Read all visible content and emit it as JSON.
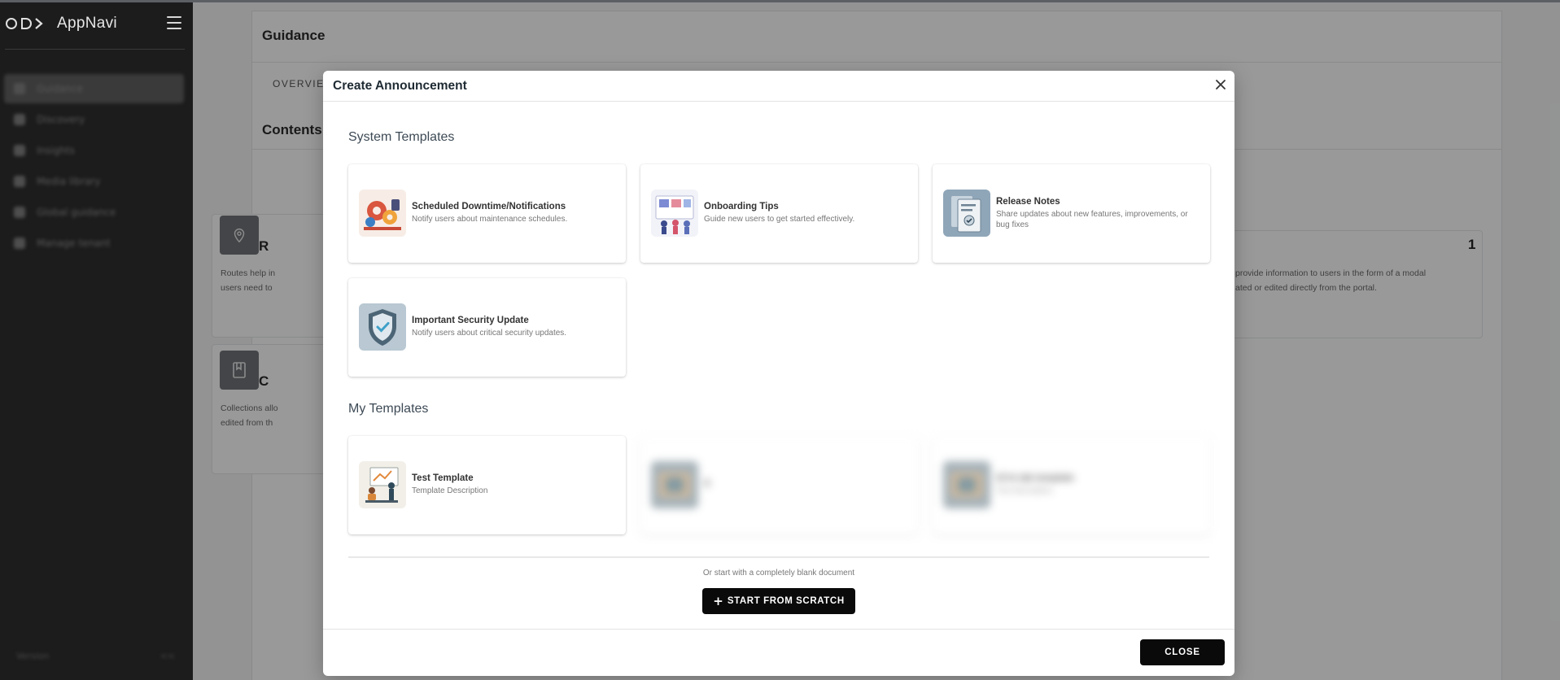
{
  "app": {
    "name": "AppNavi"
  },
  "sidebar": {
    "items": [
      {
        "label": "Guidance",
        "active": true
      },
      {
        "label": "Discovery"
      },
      {
        "label": "Insights"
      },
      {
        "label": "Media library"
      },
      {
        "label": "Global guidance"
      },
      {
        "label": "Manage tenant"
      }
    ],
    "footer": {
      "left": "Version",
      "right": "<<"
    }
  },
  "page": {
    "title": "Guidance",
    "tab_overview": "OVERVIEW",
    "contents_title": "Contents",
    "tiles": {
      "routes": {
        "initial": "R",
        "text1": "Routes help in",
        "text2": "users need to"
      },
      "collections": {
        "initial": "C",
        "text1": "Collections allo",
        "text2": "edited from th"
      },
      "announcements": {
        "count": "1",
        "text1": "provide information to users in the form of a modal",
        "text2": "ated or edited directly from the portal."
      }
    }
  },
  "modal": {
    "title": "Create Announcement",
    "system_heading": "System Templates",
    "my_heading": "My Templates",
    "system_templates": [
      {
        "name": "Scheduled Downtime/Notifications",
        "description": "Notify users about maintenance schedules."
      },
      {
        "name": "Onboarding Tips",
        "description": "Guide new users to get started effectively."
      },
      {
        "name": "Release Notes",
        "description": "Share updates about new features, improvements, or bug fixes"
      },
      {
        "name": "Important Security Update",
        "description": "Notify users about critical security updates."
      }
    ],
    "my_templates": [
      {
        "name": "Test Template",
        "description": "Template Description"
      },
      {
        "name": "X",
        "description": ""
      },
      {
        "name": "UI In tab template",
        "description": "Test description"
      }
    ],
    "blank_hint": "Or start with a completely blank document",
    "start_scratch_label": "START FROM SCRATCH",
    "close_label": "CLOSE"
  }
}
